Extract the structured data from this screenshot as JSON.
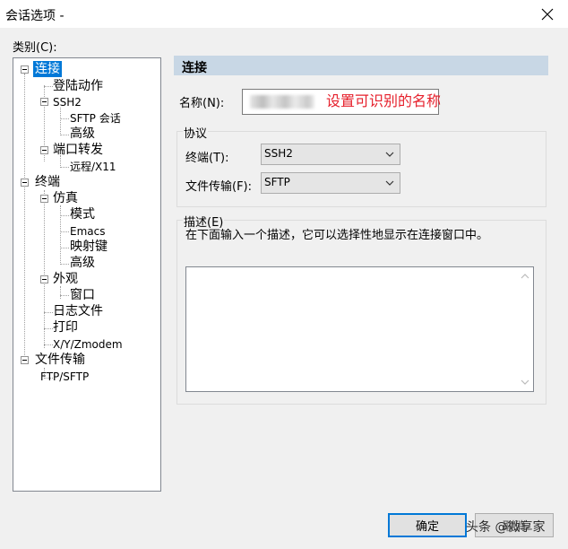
{
  "window": {
    "title": "会话选项 -"
  },
  "category_label": "类别(C):",
  "tree": {
    "connection": "连接",
    "login_actions": "登陆动作",
    "ssh2": "SSH2",
    "sftp_session": "SFTP 会话",
    "advanced_ssh2": "高级",
    "port_forwarding": "端口转发",
    "remote_x11": "远程/X11",
    "terminal": "终端",
    "emulation": "仿真",
    "modes": "模式",
    "emacs": "Emacs",
    "mapped_keys": "映射键",
    "advanced_emulation": "高级",
    "appearance": "外观",
    "window": "窗口",
    "log_file": "日志文件",
    "printing": "打印",
    "xyzmodem": "X/Y/Zmodem",
    "file_transfer": "文件传输",
    "ftp_sftp": "FTP/SFTP"
  },
  "panel": {
    "header": "连接",
    "name_label": "名称(N):",
    "name_annotation": "设置可识别的名称",
    "protocol_group": "协议",
    "terminal_label": "终端(T):",
    "terminal_value": "SSH2",
    "file_transfer_label": "文件传输(F):",
    "file_transfer_value": "SFTP",
    "description_group": "描述(E)",
    "description_hint": "在下面输入一个描述，它可以选择性地显示在连接窗口中。"
  },
  "buttons": {
    "ok": "确定",
    "cancel": "取消"
  },
  "watermark": "头条 @微享家",
  "colors": {
    "selection": "#0078d7",
    "header_bg": "#c8d7e5",
    "annotation": "#e6202c"
  }
}
